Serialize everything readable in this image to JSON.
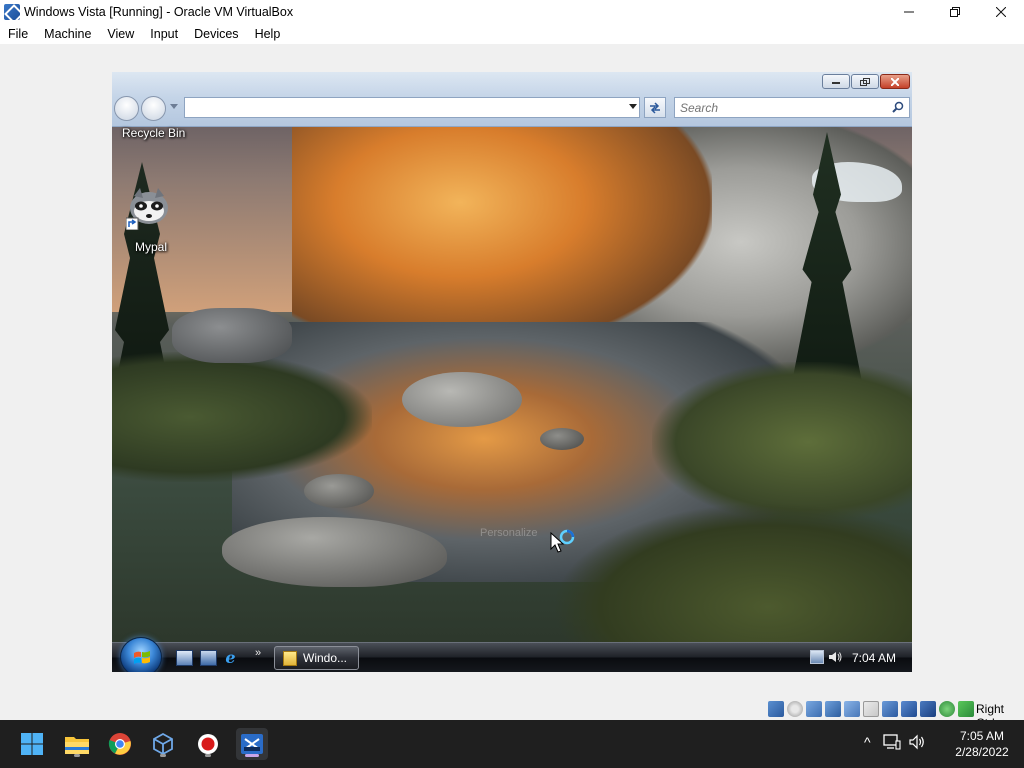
{
  "host_window": {
    "title": "Windows Vista [Running] - Oracle VM VirtualBox",
    "controls": [
      "minimize",
      "restore",
      "close"
    ]
  },
  "host_menu": [
    "File",
    "Machine",
    "View",
    "Input",
    "Devices",
    "Help"
  ],
  "vista_explorer": {
    "address_value": "",
    "search_placeholder": "Search"
  },
  "desktop_icons": [
    {
      "label": "Recycle Bin",
      "icon": "recycle-bin-icon"
    },
    {
      "label": "Mypal",
      "icon": "mypal-raccoon-icon"
    }
  ],
  "personalize_hint": "Personalize",
  "vista_taskbar": {
    "quick_launch": [
      "show-desktop-icon",
      "switch-windows-icon",
      "internet-explorer-icon"
    ],
    "overflow": "»",
    "task_button_label": "Windo...",
    "clock": "7:04 AM"
  },
  "vbox_status": {
    "icons": [
      "hard-disk-icon",
      "optical-drive-icon",
      "audio-icon",
      "network-icon",
      "usb-icon",
      "shared-folder-icon",
      "display-icon",
      "video-capture-icon",
      "cpu-icon",
      "mouse-integration-icon",
      "keyboard-icon"
    ],
    "host_key": "Right Ctrl"
  },
  "win11_taskbar": {
    "apps": [
      "start-icon",
      "file-explorer-icon",
      "chrome-icon",
      "virtualbox-icon",
      "record-icon",
      "vista-vm-icon"
    ],
    "tray_symbols": [
      "^"
    ],
    "time": "7:05 AM",
    "date": "2/28/2022"
  },
  "colors": {
    "host_chrome": "#ffffff",
    "vm_background": "#f0f0f0",
    "vista_taskbar": "#1f2228",
    "win11_taskbar": "#1f1f1f",
    "active_indicator": "#c8a5e8"
  }
}
